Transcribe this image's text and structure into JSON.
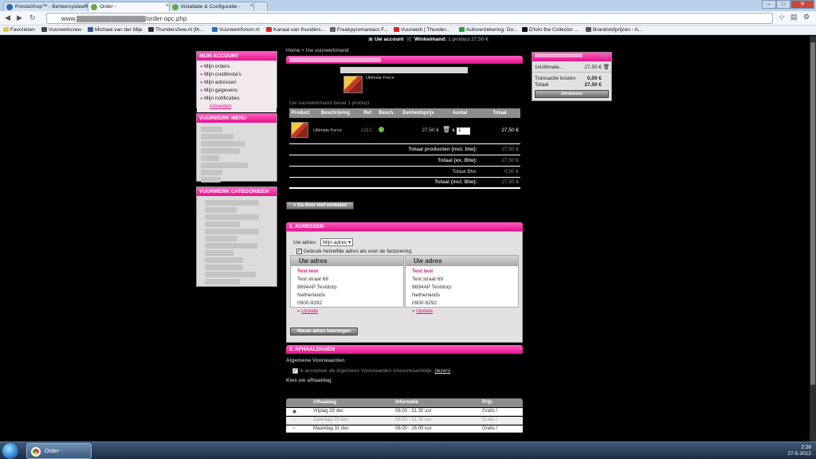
{
  "browser": {
    "tabs": [
      {
        "label": "PrestaShop™ - Beheersysteem",
        "active": false
      },
      {
        "label": "Order - ",
        "active": true
      },
      {
        "label": "Installatie & Configuratie -",
        "active": false
      }
    ],
    "url": {
      "prefix": "www.",
      "path": "/order-opc.php"
    },
    "bookmarks": [
      "Favorieten",
      "Vuurwerkcrew",
      "Michael van der Mije",
      "Thundershow.nl (th...",
      "Vuurwerkforum.nl",
      "Kanaal van thunders...",
      "Freakpyromaniacs F...",
      "Vuurwerk | Thunder...",
      "Autoverzekering: Go...",
      "D'lom the Collector ...",
      "Brandstofprijzen - A..."
    ]
  },
  "topbar": {
    "account": "Uw account",
    "cart_label": "Winkelmand:",
    "cart_value": "1 product 27,50 €"
  },
  "my_account": {
    "title": "MIJN ACCOUNT",
    "items": [
      "Mijn orders",
      "Mijn creditnota's",
      "Mijn adressen",
      "Mijn gegevens",
      "Mijn notificaties"
    ],
    "logout": "Afmelden"
  },
  "menu": {
    "title": "VUURWERK MENU"
  },
  "categories": {
    "title": "VUURWERK CATEGORIEEN"
  },
  "breadcrumb": {
    "home": "Home",
    "sep": ">",
    "current": "Uw vuurwerkmand"
  },
  "cart": {
    "product_name": "Ultimate Force",
    "summary": "Uw vuurwerkmand bevat 1 product",
    "headers": [
      "Product",
      "Beschrijving",
      "Ref.",
      "Besch.",
      "Eenheidsprijs",
      "Aantal",
      "Totaal"
    ],
    "row": {
      "desc": "Ultimate Force",
      "ref": "c112",
      "unit": "27,50 €",
      "qty": "1",
      "total": "27,50 €"
    },
    "totals": [
      {
        "label": "Totaal producten (incl. btw):",
        "value": "27,50 €"
      },
      {
        "label": "Totaal (ex. Btw):",
        "value": "27,50 €"
      },
      {
        "label": "Totaal Btw:",
        "value": "0,00 €"
      },
      {
        "label": "Totaal (incl. Btw):",
        "value": "27,50 €"
      }
    ],
    "continue": "« Ga door met winkelen"
  },
  "addresses": {
    "title": "1. ADRESSEN",
    "your_address": "Uw adres:",
    "select_value": "Mijn adres",
    "same_invoice": "Gebruik hetzelfde adres als voor de facturering.",
    "box_title": "Uw adres",
    "name": "Test test",
    "street": "Test straat 69",
    "city": "8694AP Testdorp",
    "country": "Netherlands",
    "phone": "0900-9292",
    "update": "Update",
    "add_button": "Nieuw adres toevoegen"
  },
  "delivery": {
    "title": "2. AFHAALDAGEN",
    "terms_title": "Algemene Voorwaarden",
    "terms_text": "Ik accepteer de Algemene Voorwaarden onvoorwaardelijk.",
    "terms_link": "(lezen)",
    "choose_title": "Kies uw afhaaldag",
    "headers": [
      "Afhaaldag",
      "Informatie",
      "Prijs"
    ],
    "rows": [
      {
        "day": "Vrijdag 28 dec",
        "info": "08.00 - 21.30 uur",
        "price": "Gratis !"
      },
      {
        "day": "Zaterdag 29 dec",
        "info": "08.00 - 21.30 uur",
        "price": "Gratis !"
      },
      {
        "day": "Maandag 31 dec",
        "info": "08.00 - 16.00 uur",
        "price": "Gratis !"
      }
    ]
  },
  "minicart": {
    "item": "1xUltimate...",
    "item_price": "27,50 €",
    "shipping_label": "Transactie kosten",
    "shipping_value": "0,00 €",
    "total_label": "Totaal",
    "total_value": "27,50 €",
    "button": "Afrekenen"
  },
  "taskbar": {
    "task": "Order -",
    "time": "2:26",
    "date": "27-5-2012"
  }
}
